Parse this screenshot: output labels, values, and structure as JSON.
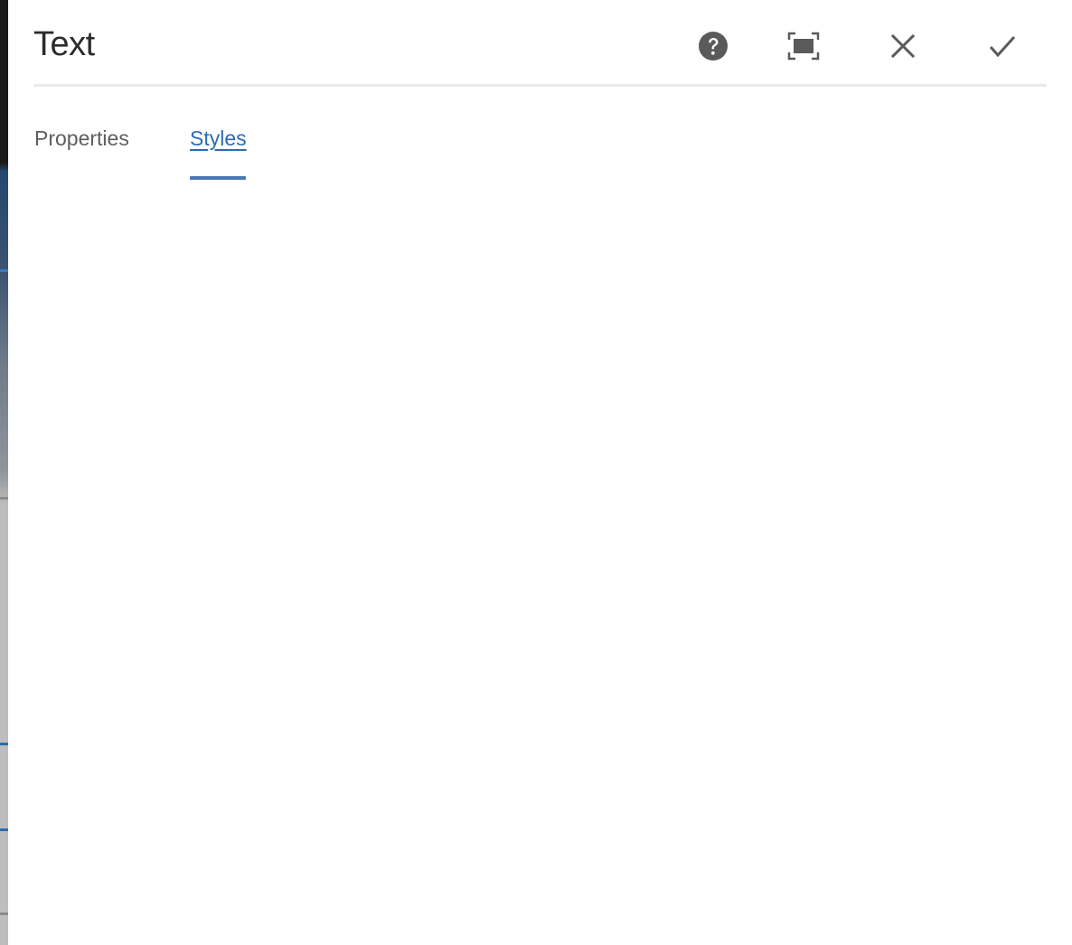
{
  "dialog": {
    "title": "Text",
    "actions": {
      "help": "help-icon",
      "fullscreen": "fullscreen-icon",
      "cancel": "close-icon",
      "done": "checkmark-icon"
    }
  },
  "tabs": [
    {
      "label": "Properties",
      "active": false
    },
    {
      "label": "Styles",
      "active": true
    }
  ],
  "colors": {
    "accent": "#2d6bb5",
    "indicator": "#4a78b3",
    "icon": "#5a5a5a",
    "text": "#2c2c2c"
  }
}
